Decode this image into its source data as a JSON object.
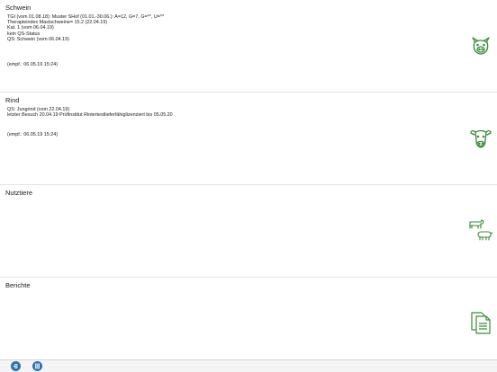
{
  "sections": {
    "schwein": {
      "title": "Schwein",
      "lines": [
        "TGI (vom 01.08.18): Muster SHof (01.01.-30.06.): A=12, G=7, G=**, U=**",
        "Therapieindex Mastschweine= 15.2 (22.04.19)",
        "Kat. 1  (vom 06.04.19)",
        "kein QS-Status",
        "QS: Schwein  (vom 06.04.19)"
      ],
      "received": "(empf.: 06.05.19 15:24)",
      "icon": "pig-icon"
    },
    "rind": {
      "title": "Rind",
      "lines": [
        "QS: Jungrind  (vom 22.04.19)",
        "letzter Besuch 20.04.19 Prüfinstitut Rintertestlieferfähiglizenziert bis 05.05.20"
      ],
      "received": "(empf.: 06.05.19 15:24)",
      "icon": "cow-icon"
    },
    "nutztiere": {
      "title": "Nutztiere",
      "icon": "livestock-icon"
    },
    "berichte": {
      "title": "Berichte",
      "icon": "documents-icon"
    }
  },
  "colors": {
    "icon_green": "#3a8a3a",
    "toolbar_blue": "#2b6fb5"
  },
  "toolbar": {
    "buttons": [
      "logout-icon",
      "list-icon"
    ]
  }
}
